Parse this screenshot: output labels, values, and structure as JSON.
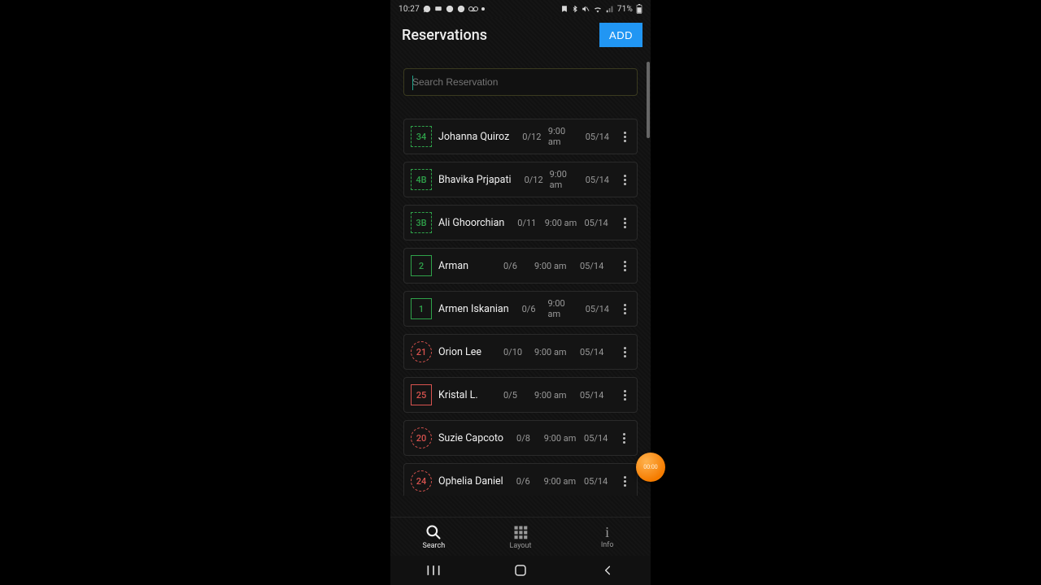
{
  "status": {
    "time": "10:27",
    "battery": "71%"
  },
  "header": {
    "title": "Reservations",
    "add_label": "ADD"
  },
  "search": {
    "placeholder": "Search Reservation"
  },
  "reservations": [
    {
      "num": "34",
      "name": "Johanna Quiroz",
      "count": "0/12",
      "time": "9:00 am",
      "date": "05/14",
      "badge_style": "square-dashed",
      "badge_color": "green"
    },
    {
      "num": "4B",
      "name": "Bhavika Prjapati",
      "count": "0/12",
      "time": "9:00 am",
      "date": "05/14",
      "badge_style": "square-dashed",
      "badge_color": "green"
    },
    {
      "num": "3B",
      "name": "Ali Ghoorchian",
      "count": "0/11",
      "time": "9:00 am",
      "date": "05/14",
      "badge_style": "square-dashed",
      "badge_color": "green"
    },
    {
      "num": "2",
      "name": "Arman",
      "count": "0/6",
      "time": "9:00 am",
      "date": "05/14",
      "badge_style": "square-solid",
      "badge_color": "green"
    },
    {
      "num": "1",
      "name": "Armen Iskanian",
      "count": "0/6",
      "time": "9:00 am",
      "date": "05/14",
      "badge_style": "square-solid",
      "badge_color": "green"
    },
    {
      "num": "21",
      "name": "Orion Lee",
      "count": "0/10",
      "time": "9:00 am",
      "date": "05/14",
      "badge_style": "circle-dashed",
      "badge_color": "red"
    },
    {
      "num": "25",
      "name": "Kristal L.",
      "count": "0/5",
      "time": "9:00 am",
      "date": "05/14",
      "badge_style": "square-solid",
      "badge_color": "red"
    },
    {
      "num": "20",
      "name": "Suzie Capcoto",
      "count": "0/8",
      "time": "9:00 am",
      "date": "05/14",
      "badge_style": "circle-dashed",
      "badge_color": "red"
    },
    {
      "num": "24",
      "name": "Ophelia Daniel",
      "count": "0/6",
      "time": "9:00 am",
      "date": "05/14",
      "badge_style": "circle-dashed",
      "badge_color": "red"
    }
  ],
  "tabs": {
    "search": "Search",
    "layout": "Layout",
    "info": "Info"
  },
  "record_bubble": "00:00"
}
